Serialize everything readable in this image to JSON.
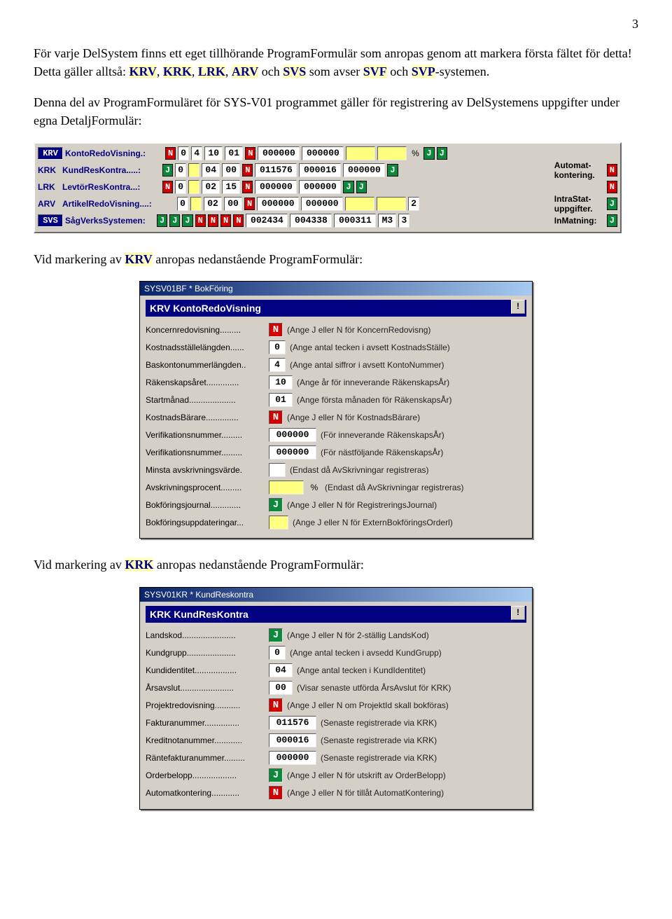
{
  "page_number": "3",
  "para1_a": "För varje DelSystem finns ett eget tillhörande ProgramFormulär som anropas genom att markera första fältet för detta! Detta gäller alltså: ",
  "para1_codes": [
    "KRV",
    "KRK",
    "LRK",
    "ARV",
    "SVS"
  ],
  "para1_mid1": " och ",
  "para1_mid2": " som avser ",
  "para1_codes2": [
    "SVF",
    "SVP"
  ],
  "para1_end": "-systemen.",
  "para2": "Denna del av ProgramFormuläret för SYS-V01 programmet gäller för registrering av DelSystemens uppgifter under egna DetaljFormulär:",
  "para3_a": "Vid markering av ",
  "para3_code": "KRV",
  "para3_b": " anropas nedanstående ProgramFormulär:",
  "para4_a": "Vid markering av ",
  "para4_code": "KRK",
  "para4_b": " anropas nedanstående ProgramFormulär:",
  "panel1": {
    "rows": [
      {
        "abbr": "KRV",
        "label": "KontoRedoVisning.:",
        "pre": [
          "N"
        ],
        "pre_type": [
          "red"
        ],
        "cells": [
          "0",
          "4",
          "10",
          "01"
        ],
        "mid": "N",
        "mid_type": "red",
        "nums": [
          "000000",
          "000000"
        ],
        "after": [
          "",
          "",
          "%"
        ],
        "tail": [
          "J",
          "J"
        ],
        "tail_type": [
          "grn",
          "grn"
        ],
        "right_label": "",
        "right_chip": ""
      },
      {
        "abbr": "KRK",
        "label": "KundResKontra.....:",
        "pre": [
          "J"
        ],
        "pre_type": [
          "grn"
        ],
        "cells": [
          "0",
          "",
          "04",
          "00"
        ],
        "mid": "N",
        "mid_type": "red",
        "nums": [
          "011576",
          "000016",
          "000000"
        ],
        "after": [],
        "tail": [
          "J"
        ],
        "tail_type": [
          "grn"
        ],
        "right_label": "Automat-\nkontering.",
        "right_chip": "N"
      },
      {
        "abbr": "LRK",
        "label": "LevtörResKontra...:",
        "pre": [
          "N"
        ],
        "pre_type": [
          "red"
        ],
        "cells": [
          "0",
          "",
          "02",
          "15"
        ],
        "mid": "N",
        "mid_type": "red",
        "nums": [
          "000000",
          "000000"
        ],
        "after": [],
        "tail": [
          "J",
          "J"
        ],
        "tail_type": [
          "grn",
          "grn"
        ],
        "right_label": "",
        "right_chip": "N"
      },
      {
        "abbr": "ARV",
        "label": "ArtikelRedoVisning....:",
        "pre": [],
        "pre_type": [],
        "cells": [
          "0",
          "",
          "02",
          "00"
        ],
        "mid": "N",
        "mid_type": "red",
        "nums": [
          "000000",
          "000000"
        ],
        "after": [
          "",
          "",
          "2"
        ],
        "tail": [],
        "tail_type": [],
        "right_label": "IntraStat-\nuppgifter.",
        "right_chip": "J"
      },
      {
        "abbr": "SVS",
        "label": "SågVerksSystemen:",
        "pre": [
          "J",
          "J",
          "J",
          "N",
          "N",
          "N"
        ],
        "pre_type": [
          "grn",
          "grn",
          "grn",
          "red",
          "red",
          "red"
        ],
        "cells": [],
        "mid": "N",
        "mid_type": "red",
        "nums": [
          "002434",
          "004338",
          "000311"
        ],
        "after": [
          "M3",
          "3"
        ],
        "tail": [],
        "tail_type": [],
        "right_label": "InMatning:",
        "right_chip": "J"
      }
    ]
  },
  "dlg1": {
    "title": "SYSV01BF * BokFöring",
    "header": "KRV KontoRedoVisning",
    "bang": "!",
    "rows": [
      {
        "label": "Koncernredovisning.........",
        "type": "chip-N",
        "value": "N",
        "hint": "(Ange J eller N för KoncernRedovisng)"
      },
      {
        "label": "Kostnadsställelängden......",
        "type": "val",
        "value": "0",
        "hint": "(Ange antal tecken i avsett KostnadsStälle)"
      },
      {
        "label": "Baskontonummerlängden..",
        "type": "val",
        "value": "4",
        "hint": "(Ange antal siffror i avsett KontoNummer)"
      },
      {
        "label": "Räkenskapsåret..............",
        "type": "val",
        "value": "10",
        "hint": "(Ange år för inneverande RäkenskapsÅr)"
      },
      {
        "label": "Startmånad....................",
        "type": "val",
        "value": "01",
        "hint": "(Ange första månaden för RäkenskapsÅr)"
      },
      {
        "label": "KostnadsBärare..............",
        "type": "chip-N",
        "value": "N",
        "hint": "(Ange J eller N för KostnadsBärare)"
      },
      {
        "label": "Verifikationsnummer.........",
        "type": "val",
        "value": "000000",
        "hint": "(För inneverande RäkenskapsÅr)"
      },
      {
        "label": "Verifikationsnummer.........",
        "type": "val",
        "value": "000000",
        "hint": "(För nästföljande RäkenskapsÅr)"
      },
      {
        "label": "Minsta avskrivningsvärde.",
        "type": "val",
        "value": "",
        "hint": "(Endast då AvSkrivningar registreras)"
      },
      {
        "label": "Avskrivningsprocent.........",
        "type": "pct",
        "value": "%",
        "hint": "(Endast då AvSkrivningar registreras)"
      },
      {
        "label": "Bokföringsjournal.............",
        "type": "chip-J",
        "value": "J",
        "hint": "(Ange J eller N för RegistreringsJournal)"
      },
      {
        "label": "Bokföringsuppdateringar...",
        "type": "val-y",
        "value": "",
        "hint": "(Ange J eller N för ExternBokföringsOrderl)"
      }
    ]
  },
  "dlg2": {
    "title": "SYSV01KR * KundReskontra",
    "header": "KRK KundResKontra",
    "bang": "!",
    "rows": [
      {
        "label": "Landskod.......................",
        "type": "chip-J",
        "value": "J",
        "hint": "(Ange J eller N för 2-ställig LandsKod)"
      },
      {
        "label": "Kundgrupp.....................",
        "type": "val",
        "value": "0",
        "hint": "(Ange antal tecken i avsedd KundGrupp)"
      },
      {
        "label": "Kundidentitet..................",
        "type": "val",
        "value": "04",
        "hint": "(Ange antal tecken i KundIdentitet)"
      },
      {
        "label": "Årsavslut.......................",
        "type": "val",
        "value": "00",
        "hint": "(Visar senaste utförda ÅrsAvslut för KRK)"
      },
      {
        "label": "Projektredovisning...........",
        "type": "chip-N",
        "value": "N",
        "hint": "(Ange J eller N om ProjektId skall bokföras)"
      },
      {
        "label": "Fakturanummer...............",
        "type": "val",
        "value": "011576",
        "hint": "(Senaste registrerade via KRK)"
      },
      {
        "label": "Kreditnotanummer............",
        "type": "val",
        "value": "000016",
        "hint": "(Senaste registrerade via KRK)"
      },
      {
        "label": "Räntefakturanummer.........",
        "type": "val",
        "value": "000000",
        "hint": "(Senaste registrerade via KRK)"
      },
      {
        "label": "Orderbelopp...................",
        "type": "chip-J",
        "value": "J",
        "hint": "(Ange J eller N för utskrift av OrderBelopp)"
      },
      {
        "label": "Automatkontering............",
        "type": "chip-N",
        "value": "N",
        "hint": "(Ange J eller N för tillåt AutomatKontering)"
      }
    ]
  }
}
